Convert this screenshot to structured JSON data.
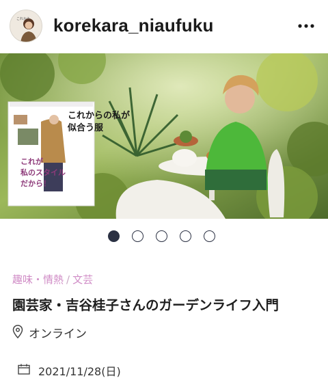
{
  "header": {
    "username": "korekara_niaufuku",
    "avatar_icon": "profile-avatar",
    "more_icon": "more-horizontal-icon"
  },
  "photo": {
    "book_title_line1": "これからの私が",
    "book_title_line2": "似合う服",
    "book_subtitle_line1": "これが",
    "book_subtitle_line2": "私のスタイル",
    "book_subtitle_line3": "だから！"
  },
  "carousel": {
    "count": 5,
    "active_index": 0
  },
  "event": {
    "category_1": "趣味・情熱",
    "category_separator": "/",
    "category_2": "文芸",
    "title": "園芸家・吉谷桂子さんのガーデンライフ入門",
    "location": "オンライン",
    "date": "2021/11/28(日)"
  },
  "colors": {
    "category": "#d08cc6",
    "dot_active": "#2b3143",
    "title": "#1f1f1f"
  }
}
